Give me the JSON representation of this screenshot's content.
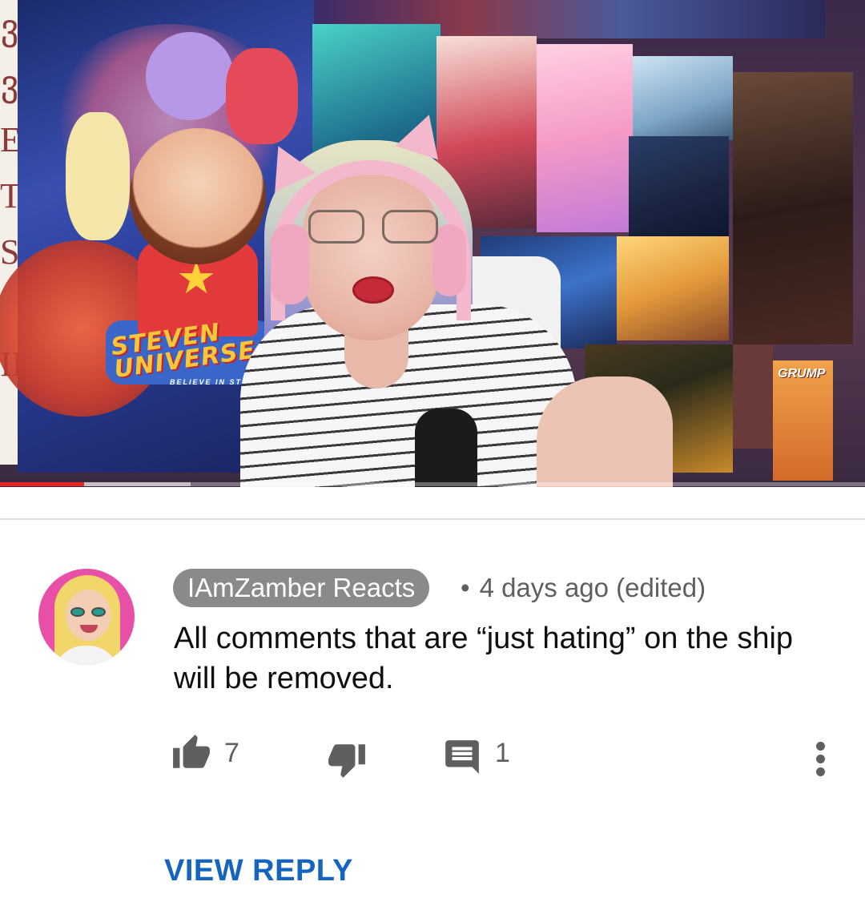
{
  "video": {
    "poster_logo_line1": "STEVEN",
    "poster_logo_line2": "UNIVERSE",
    "poster_tagline": "BELIEVE IN STEVE",
    "poster_side_text": "GRUMP",
    "progress_fraction": 0.097,
    "buffered_fraction": 0.22,
    "progress_color": "#e52521"
  },
  "comment": {
    "author": "IAmZamber Reacts",
    "separator": "•",
    "timestamp": "4 days ago (edited)",
    "text": "All comments that are “just hating” on the ship will be removed.",
    "like_count": "7",
    "reply_count": "1",
    "icons": {
      "like": "thumbs-up-icon",
      "dislike": "thumbs-down-icon",
      "reply": "comment-icon",
      "more": "more-vertical-icon"
    },
    "author_chip_color": "#8a8a8a"
  },
  "view_reply_label": "VIEW REPLY",
  "colors": {
    "link": "#1565c0",
    "meta_text": "#5f5f5f",
    "body_text": "#0f0f0f"
  }
}
